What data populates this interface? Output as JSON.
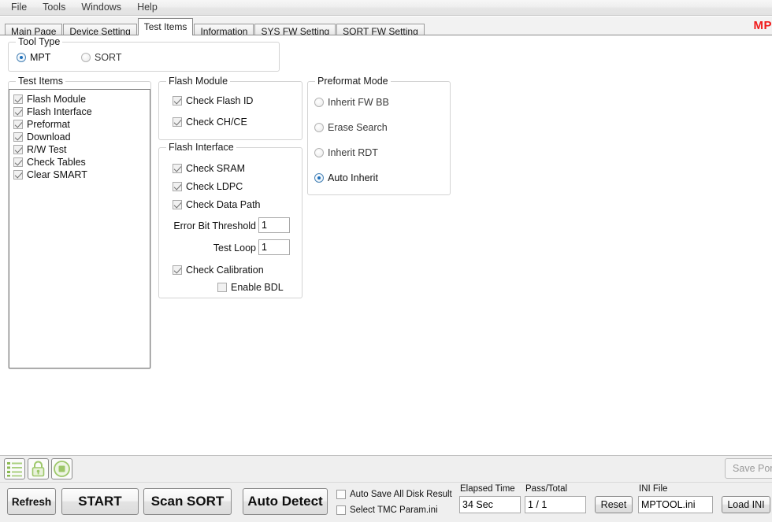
{
  "menu": {
    "items": [
      {
        "label": "File",
        "name": "menu-file"
      },
      {
        "label": "Tools",
        "name": "menu-tools"
      },
      {
        "label": "Windows",
        "name": "menu-windows"
      },
      {
        "label": "Help",
        "name": "menu-help"
      }
    ]
  },
  "brand": {
    "text": "MP"
  },
  "tabs": [
    {
      "label": "Main Page",
      "selected": false
    },
    {
      "label": "Device Setting",
      "selected": false
    },
    {
      "label": "Test Items",
      "selected": true
    },
    {
      "label": "Information",
      "selected": false
    },
    {
      "label": "SYS FW Setting",
      "selected": false
    },
    {
      "label": "SORT FW Setting",
      "selected": false
    }
  ],
  "tool_type": {
    "legend": "Tool Type",
    "options": [
      {
        "label": "MPT",
        "selected": true
      },
      {
        "label": "SORT",
        "selected": false
      }
    ]
  },
  "test_items": {
    "legend": "Test Items",
    "items": [
      {
        "label": "Flash Module",
        "checked": true
      },
      {
        "label": "Flash Interface",
        "checked": true
      },
      {
        "label": "Preformat",
        "checked": true
      },
      {
        "label": "Download",
        "checked": true
      },
      {
        "label": "R/W Test",
        "checked": true
      },
      {
        "label": "Check Tables",
        "checked": true
      },
      {
        "label": "Clear SMART",
        "checked": true
      }
    ]
  },
  "flash_module": {
    "legend": "Flash Module",
    "items": [
      {
        "label": "Check Flash ID",
        "checked": true
      },
      {
        "label": "Check CH/CE",
        "checked": true
      }
    ]
  },
  "flash_interface": {
    "legend": "Flash Interface",
    "items": [
      {
        "label": "Check SRAM",
        "checked": true
      },
      {
        "label": "Check LDPC",
        "checked": true
      },
      {
        "label": "Check Data Path",
        "checked": true
      }
    ],
    "fields": [
      {
        "label": "Error Bit Threshold",
        "value": "1"
      },
      {
        "label": "Test Loop",
        "value": "1"
      }
    ],
    "calibration": {
      "label": "Check Calibration",
      "checked": true
    },
    "enable_bdl": {
      "label": "Enable BDL",
      "checked": false
    }
  },
  "preformat_mode": {
    "legend": "Preformat Mode",
    "options": [
      {
        "label": "Inherit FW BB",
        "selected": false
      },
      {
        "label": "Erase Search",
        "selected": false
      },
      {
        "label": "Inherit RDT",
        "selected": false
      },
      {
        "label": "Auto Inherit",
        "selected": true
      }
    ]
  },
  "toolbar": {
    "icons": [
      {
        "name": "list-icon",
        "title": "list"
      },
      {
        "name": "lock-icon",
        "title": "lock"
      },
      {
        "name": "stop-icon",
        "title": "stop"
      }
    ],
    "save_port_label": "Save Port"
  },
  "actions": {
    "refresh": "Refresh",
    "start": "START",
    "scan_sort": "Scan SORT",
    "auto_detect": "Auto Detect",
    "reset": "Reset",
    "load_ini": "Load INI"
  },
  "options": {
    "auto_save_all_disk_result": {
      "label": "Auto Save All Disk Result",
      "checked": false
    },
    "select_tmc_param": {
      "label": "Select TMC Param.ini",
      "checked": false
    }
  },
  "status": {
    "elapsed_time_label": "Elapsed Time",
    "elapsed_time_value": "34 Sec",
    "pass_total_label": "Pass/Total",
    "pass_total_value": "1 / 1",
    "ini_file_label": "INI File",
    "ini_file_value": "MPTOOL.ini"
  },
  "colors": {
    "brand_red": "#f01a1a",
    "icon_green": "#8cba54",
    "accent_blue": "#1e6fba",
    "panel_gray": "#efefef"
  }
}
